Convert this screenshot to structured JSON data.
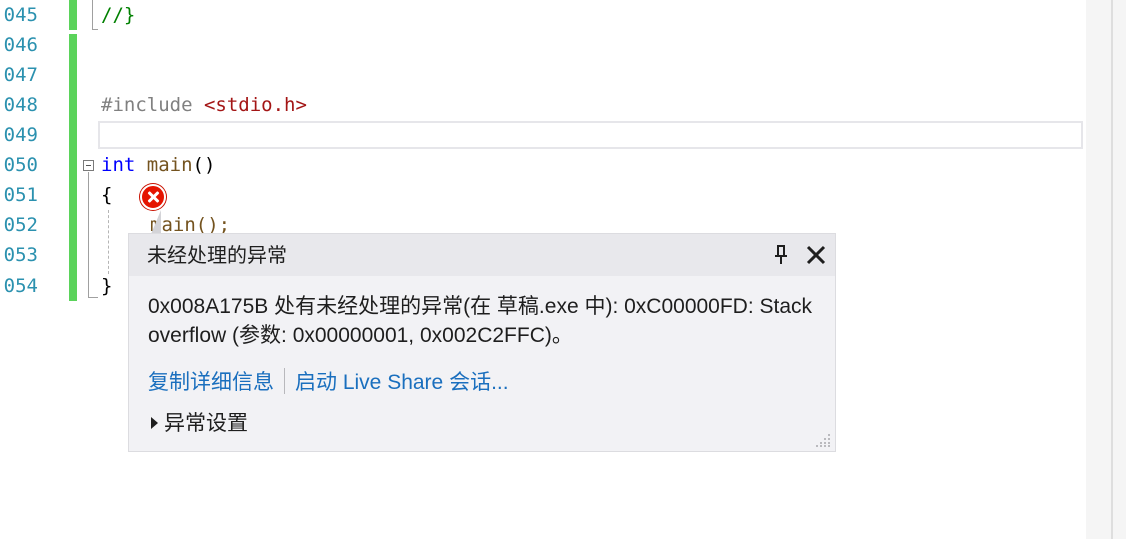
{
  "editor": {
    "line_numbers": [
      "045",
      "046",
      "047",
      "048",
      "049",
      "050",
      "051",
      "052",
      "053",
      "054"
    ],
    "code": {
      "line_045": "//}",
      "line_048_directive": "#include",
      "line_048_header": "<stdio.h>",
      "line_050_type": "int",
      "line_050_name": "main",
      "line_050_parens": "()",
      "line_051": "{",
      "line_052": "main();",
      "line_054": "}"
    },
    "colors": {
      "line_number": "#2b91af",
      "change_bar": "#5bd35b",
      "keyword": "#0000ff",
      "comment": "#008000",
      "string": "#a31515"
    }
  },
  "exception_popup": {
    "title": "未经处理的异常",
    "message": "0x008A175B 处有未经处理的异常(在 草稿.exe 中): 0xC00000FD: Stack overflow (参数: 0x00000001, 0x002C2FFC)。",
    "link_copy_details": "复制详细信息",
    "link_live_share": "启动 Live Share 会话...",
    "exception_settings": "异常设置",
    "icons": [
      "pin-icon",
      "close-icon",
      "error-icon",
      "resize-grip-icon"
    ],
    "link_color": "#1a6fbe",
    "error_color": "#e51400"
  }
}
